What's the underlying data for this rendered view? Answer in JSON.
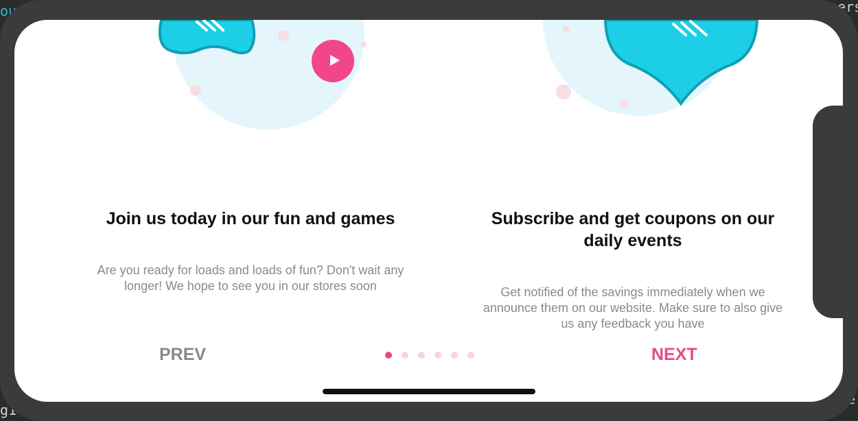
{
  "slides": [
    {
      "title": "Join us today in our fun and games",
      "description": "Are you ready for loads and loads of fun? Don't wait any longer! We hope to see you in our stores soon"
    },
    {
      "title": "Subscribe and get coupons on our daily events",
      "description": "Get notified of the savings immediately when we announce them on our website. Make sure to also give us any feedback you have"
    }
  ],
  "navigation": {
    "prev_label": "PREV",
    "next_label": "NEXT",
    "dot_count": 6,
    "active_dot": 1
  },
  "background_text": {
    "top_left": "ou",
    "top_right": "Users/",
    "bottom_left": "g1",
    "bottom_right": "ce"
  },
  "colors": {
    "accent": "#e64a8b",
    "illustration": "#1ccfe6",
    "bubble": "#e4f6fb",
    "play_button": "#f2468a"
  },
  "icons": [
    "play-icon",
    "game-controller-icon",
    "heart-icon"
  ]
}
